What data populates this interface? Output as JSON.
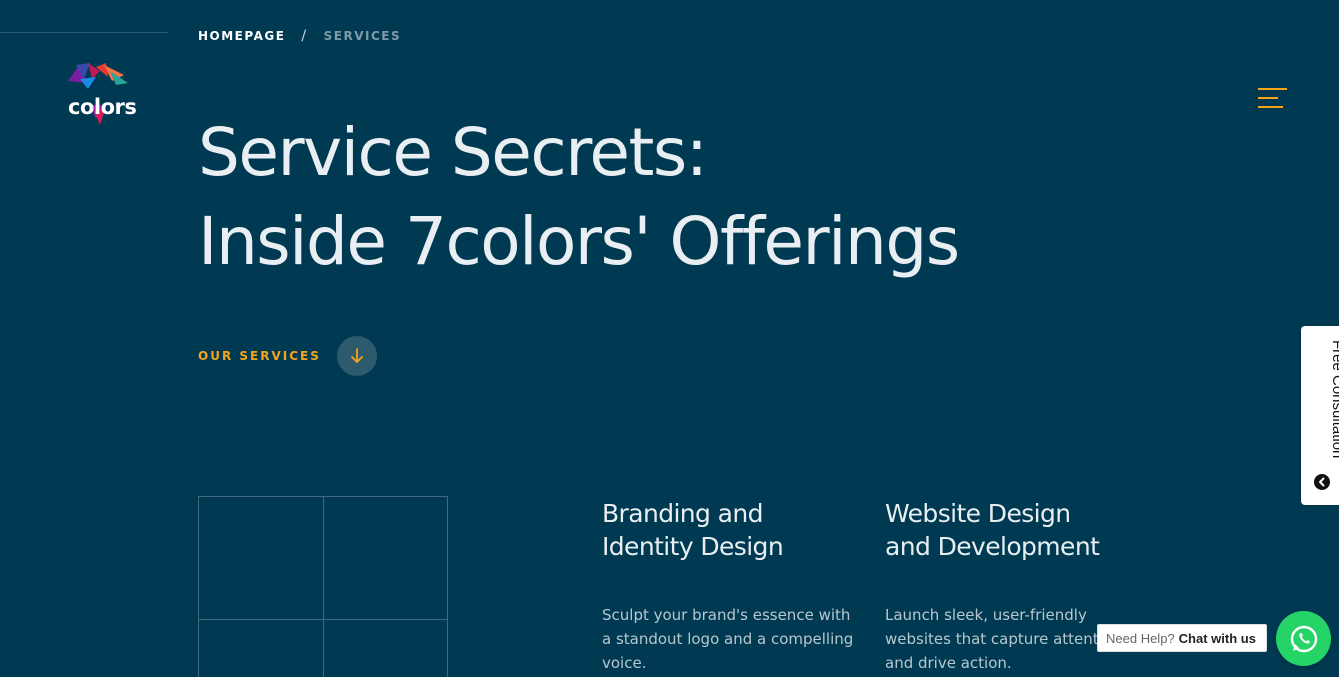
{
  "brand": {
    "logo_text": "colors",
    "logo_icon": "colorful-triangle-logo-icon"
  },
  "breadcrumb": {
    "home": "HOMEPAGE",
    "separator": "/",
    "current": "SERVICES"
  },
  "menu": {
    "icon": "hamburger-menu-icon",
    "accent_color": "#f6a319"
  },
  "hero": {
    "line1": "Service Secrets:",
    "line2": "Inside 7colors' Offerings"
  },
  "services_link": {
    "label": "OUR SERVICES",
    "icon": "arrow-down-icon"
  },
  "services": [
    {
      "title_line1": "Branding and",
      "title_line2": "Identity Design",
      "desc": "Sculpt your brand's essence with a standout logo and a compelling voice."
    },
    {
      "title_line1": "Website Design",
      "title_line2": "and Development",
      "desc": "Launch sleek, user-friendly websites that capture attention and drive action."
    }
  ],
  "consultation": {
    "label": "Free Consultation",
    "icon": "chevron-left-circle-icon"
  },
  "chat": {
    "prompt": "Need Help?",
    "action": "Chat with us",
    "icon": "whatsapp-icon"
  },
  "colors": {
    "background": "#003a52",
    "accent": "#f6a319",
    "whatsapp": "#25d366"
  }
}
